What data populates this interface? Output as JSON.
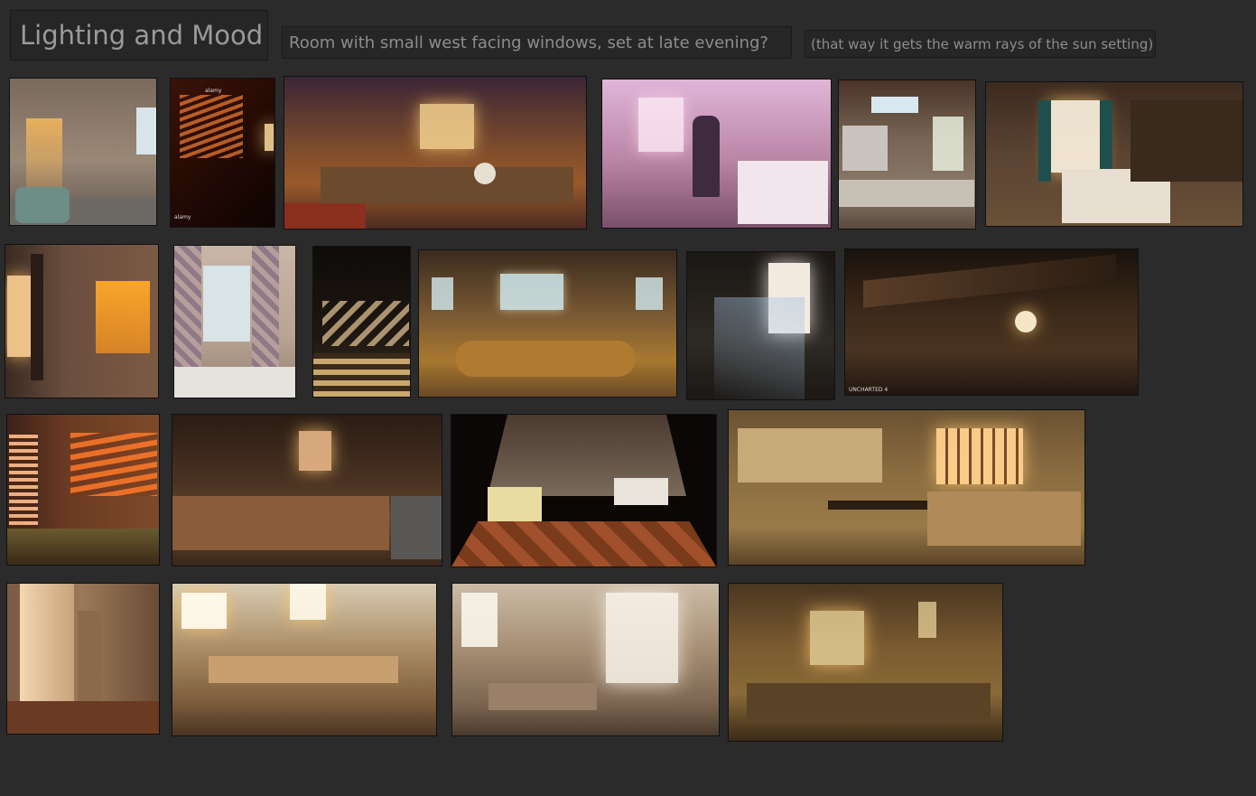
{
  "notes": {
    "title": "Lighting and Mood",
    "question": "Room with small west facing windows, set at late evening?",
    "aside": "(that way it gets the warm rays of the sun setting)"
  },
  "images": [
    {
      "id": "ref-bedroom-sun-stripes",
      "watermark": ""
    },
    {
      "id": "ref-dark-room-blinds",
      "watermark": "alamy"
    },
    {
      "id": "ref-illustrated-kitchen-skull",
      "watermark": ""
    },
    {
      "id": "ref-pink-kitchen-illustration",
      "watermark": ""
    },
    {
      "id": "ref-kitchen-skylight",
      "watermark": ""
    },
    {
      "id": "ref-bedroom-curtains",
      "watermark": ""
    },
    {
      "id": "ref-wall-sunset-window",
      "watermark": ""
    },
    {
      "id": "ref-bedroom-floral-curtains",
      "watermark": ""
    },
    {
      "id": "ref-dark-room-light-floor",
      "watermark": ""
    },
    {
      "id": "ref-cottage-kitchen-sea",
      "watermark": ""
    },
    {
      "id": "ref-window-light-beams",
      "watermark": ""
    },
    {
      "id": "ref-attic-room-game",
      "watermark": "UNCHARTED 4"
    },
    {
      "id": "ref-room-orange-blinds",
      "watermark": ""
    },
    {
      "id": "ref-dark-wood-kitchen",
      "watermark": ""
    },
    {
      "id": "ref-stylized-brick-kitchen",
      "watermark": ""
    },
    {
      "id": "ref-modern-kitchen-sepia",
      "watermark": ""
    },
    {
      "id": "ref-hallway-sunlight",
      "watermark": ""
    },
    {
      "id": "ref-painted-kitchen-bright",
      "watermark": ""
    },
    {
      "id": "ref-painted-kitchen-pale",
      "watermark": ""
    },
    {
      "id": "ref-painted-kitchen-sepia",
      "watermark": ""
    }
  ]
}
